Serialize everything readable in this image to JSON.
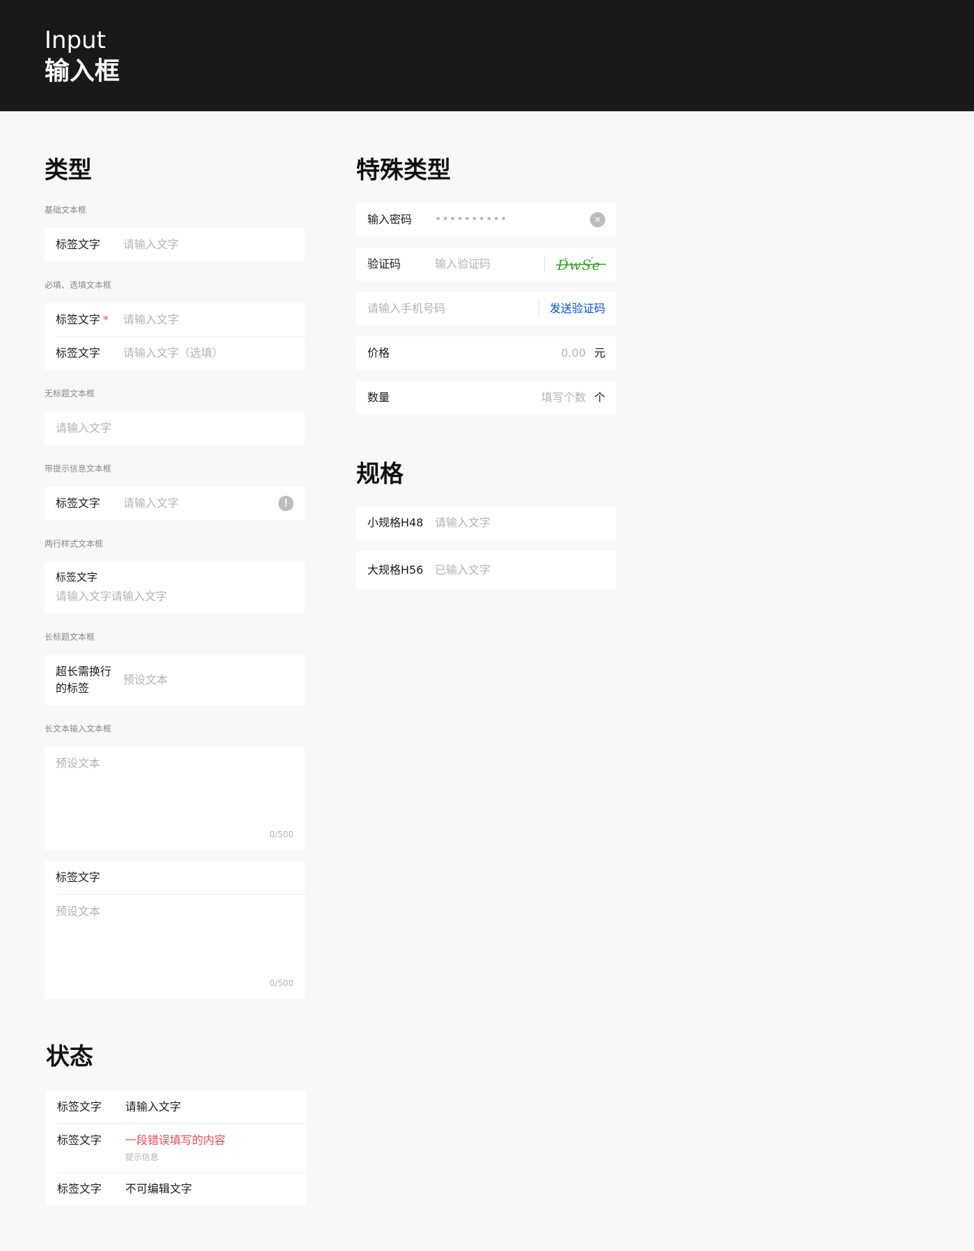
{
  "header": {
    "title_en": "Input",
    "title_cn": "输入框"
  },
  "types": {
    "title": "类型",
    "basic": {
      "caption": "基础文本框",
      "label": "标签文字",
      "placeholder": "请输入文字"
    },
    "required": {
      "caption": "必填、选填文本框",
      "label1": "标签文字",
      "star": "*",
      "placeholder1": "请输入文字",
      "label2": "标签文字",
      "placeholder2": "请输入文字（选填）"
    },
    "no_title": {
      "caption": "无标题文本框",
      "placeholder": "请输入文字"
    },
    "with_tip": {
      "caption": "带提示信息文本框",
      "label": "标签文字",
      "placeholder": "请输入文字",
      "icon_glyph": "!"
    },
    "two_line": {
      "caption": "两行样式文本框",
      "label": "标签文字",
      "placeholder": "请输入文字请输入文字"
    },
    "long_title": {
      "caption": "长标题文本框",
      "label_line1": "超长需换行",
      "label_line2": "的标签",
      "placeholder": "预设文本"
    },
    "textarea": {
      "caption": "长文本输入文本框",
      "placeholder": "预设文本",
      "counter": "0/500"
    },
    "textarea_labeled": {
      "label": "标签文字",
      "placeholder": "预设文本",
      "counter": "0/500"
    }
  },
  "special": {
    "title": "特殊类型",
    "password": {
      "label": "输入密码",
      "value": "••••••••••",
      "icon_glyph": "✕"
    },
    "captcha": {
      "label": "验证码",
      "placeholder": "输入验证码",
      "image_text": "DwSe"
    },
    "phone": {
      "placeholder": "请输入手机号码",
      "action": "发送验证码"
    },
    "price": {
      "label": "价格",
      "placeholder": "0.00",
      "unit": "元"
    },
    "quantity": {
      "label": "数量",
      "placeholder": "填写个数",
      "unit": "个"
    }
  },
  "sizes": {
    "title": "规格",
    "small": {
      "label": "小规格H48",
      "placeholder": "请输入文字"
    },
    "large": {
      "label": "大规格H56",
      "placeholder": "已输入文字"
    }
  },
  "states": {
    "title": "状态",
    "normal": {
      "label": "标签文字",
      "value": "请输入文字"
    },
    "error": {
      "label": "标签文字",
      "value": "一段错误填写的内容",
      "hint": "提示信息"
    },
    "disabled": {
      "label": "标签文字",
      "value": "不可编辑文字"
    }
  },
  "colors": {
    "header_bg": "#19191a",
    "page_bg": "#f8f8f8",
    "link": "#0052d9",
    "error": "#e34d59",
    "captcha": "#3aa12e"
  }
}
